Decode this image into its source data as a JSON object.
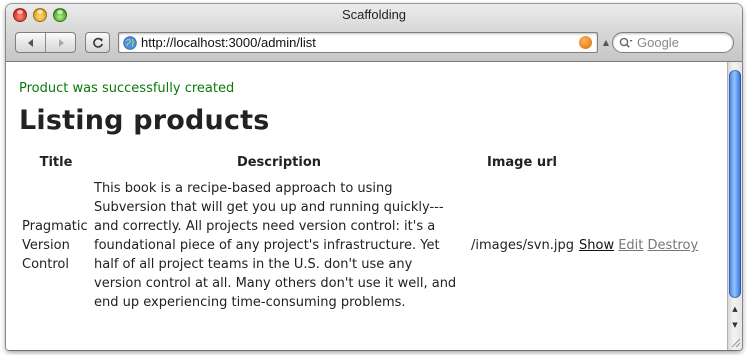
{
  "window": {
    "title": "Scaffolding"
  },
  "toolbar": {
    "back_icon": "back-arrow-icon",
    "forward_icon": "forward-arrow-icon",
    "reload_icon": "reload-icon",
    "url": "http://localhost:3000/admin/list",
    "search_placeholder": "Google"
  },
  "page": {
    "notice": "Product was successfully created",
    "heading": "Listing products",
    "table": {
      "columns": [
        "Title",
        "Description",
        "Image url"
      ],
      "rows": [
        {
          "title": "Pragmatic Version Control",
          "description": "This book is a recipe-based approach to using Subversion that will get you up and running quickly---and correctly. All projects need version control: it's a foundational piece of any project's infrastructure. Yet half of all project teams in the U.S. don't use any version control at all. Many others don't use it well, and end up experiencing time-consuming problems.",
          "image_url": "/images/svn.jpg",
          "actions": {
            "show": "Show",
            "edit": "Edit",
            "destroy": "Destroy"
          }
        }
      ]
    }
  },
  "colors": {
    "notice": "#0a7a0a",
    "scroll_thumb": "#4a8ae6"
  }
}
